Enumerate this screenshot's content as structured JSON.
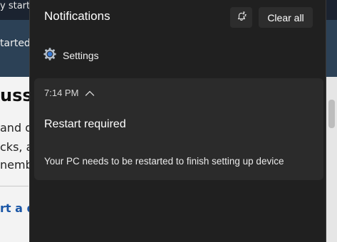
{
  "background_app": {
    "topbar_text": "y start",
    "band_text": "tarted",
    "heading": "uss",
    "paragraph_lines": [
      "and d",
      "cks, a",
      "nemb"
    ],
    "link_text": "rt a d"
  },
  "notification_center": {
    "title": "Notifications",
    "dnd_icon": "bell-zz-icon",
    "clear_all_label": "Clear all",
    "app_group": {
      "icon": "settings-gear-icon",
      "name": "Settings"
    },
    "notification": {
      "time": "7:14 PM",
      "collapse_icon": "chevron-up-icon",
      "title": "Restart required",
      "body": "Your PC needs to be restarted to finish setting up device"
    }
  },
  "colors": {
    "panel_bg": "#202020",
    "card_bg": "#2b2b2b",
    "button_bg": "#2d2d2d",
    "settings_icon_accent": "#3a7bd5"
  }
}
